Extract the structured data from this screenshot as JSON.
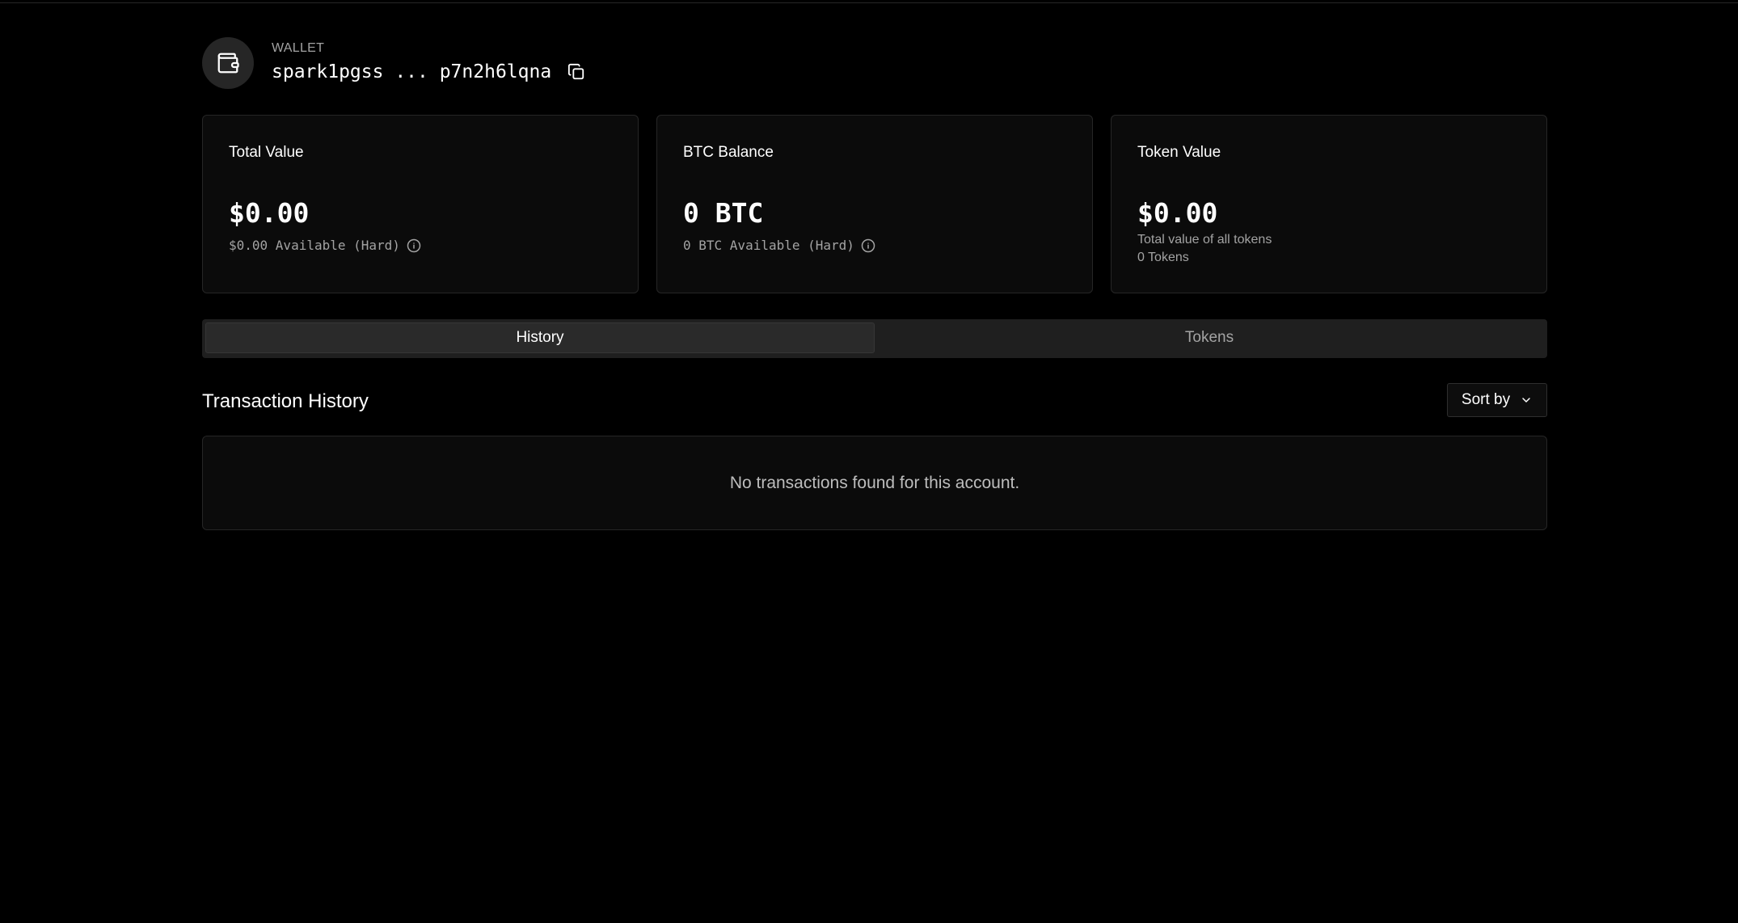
{
  "wallet": {
    "kicker": "WALLET",
    "address": "spark1pgss ... p7n2h6lqna",
    "avatar_icon": "wallet-icon",
    "copy_icon": "copy-icon"
  },
  "cards": [
    {
      "title": "Total Value",
      "value": "$0.00",
      "sub": "$0.00 Available (Hard)",
      "info_icon": "info-icon"
    },
    {
      "title": "BTC Balance",
      "value": "0 BTC",
      "sub": "0 BTC Available (Hard)",
      "info_icon": "info-icon"
    },
    {
      "title": "Token Value",
      "value": "$0.00",
      "sub_line1": "Total value of all tokens",
      "sub_line2": "0 Tokens"
    }
  ],
  "tabs": [
    {
      "label": "History",
      "active": true
    },
    {
      "label": "Tokens",
      "active": false
    }
  ],
  "history": {
    "title": "Transaction History",
    "sort_label": "Sort by",
    "sort_icon": "chevron-down-icon",
    "empty_message": "No transactions found for this account."
  },
  "colors": {
    "background": "#000000",
    "card_bg": "#0b0b0b",
    "border": "#262626",
    "muted_text": "#a3a3a3"
  }
}
